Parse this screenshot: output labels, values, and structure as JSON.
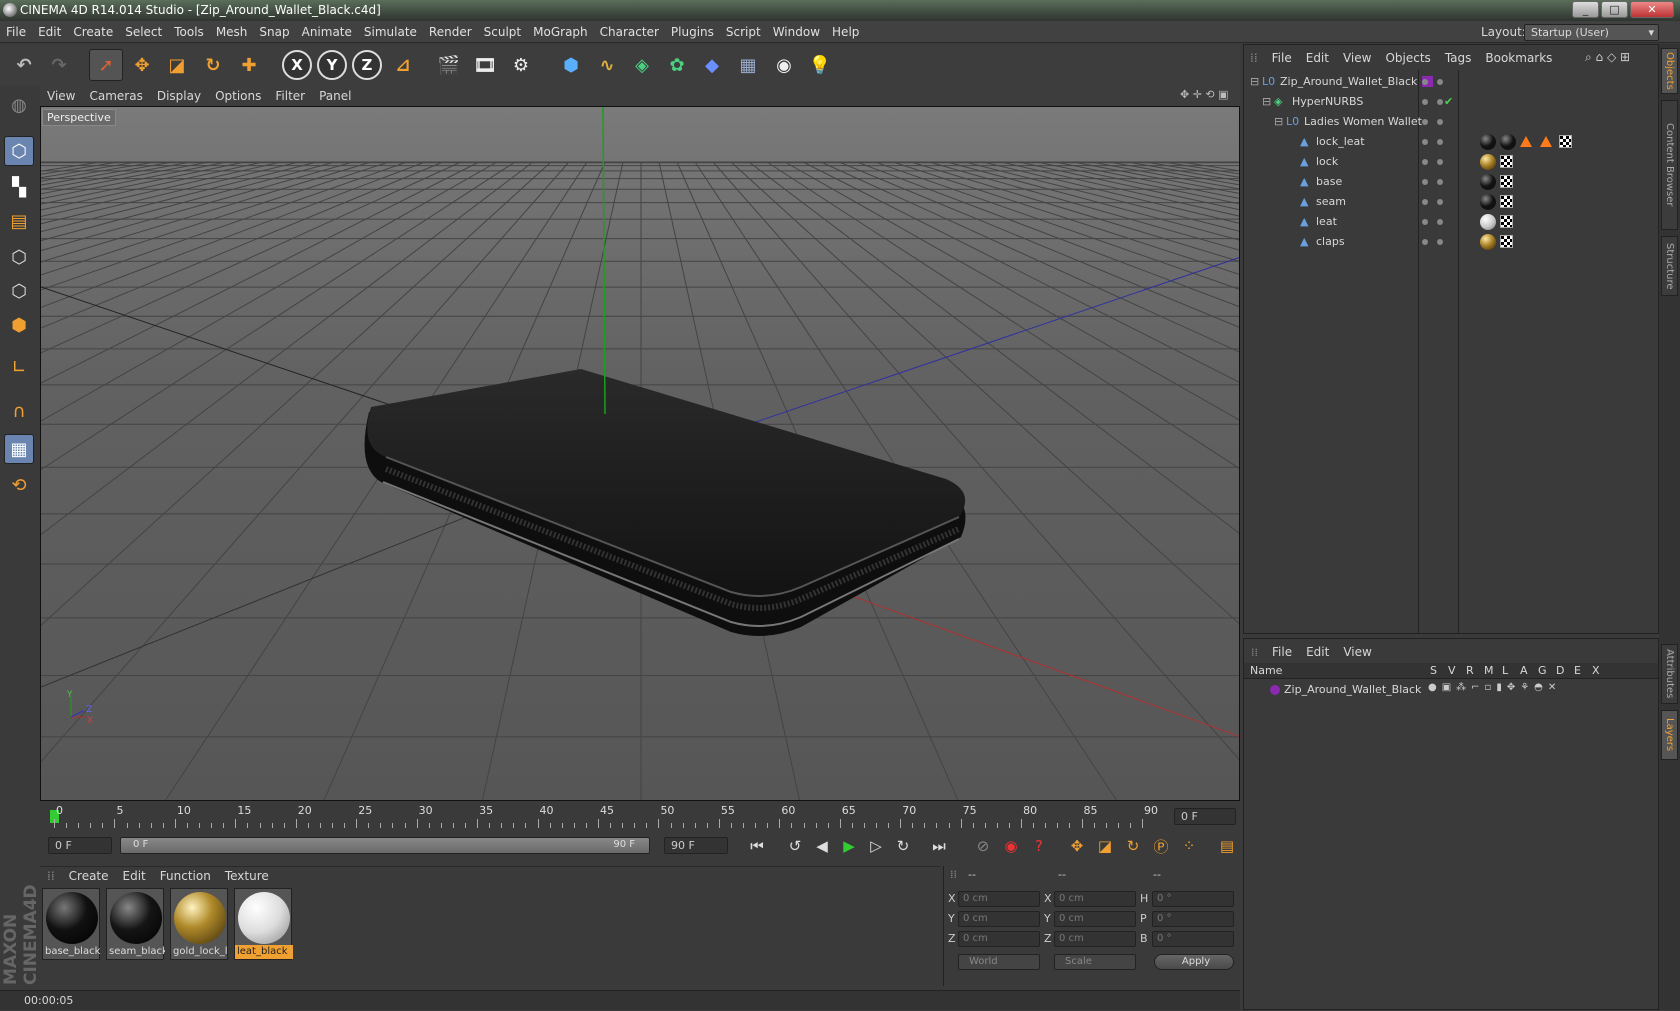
{
  "window": {
    "title": "CINEMA 4D R14.014 Studio - [Zip_Around_Wallet_Black.c4d]",
    "min": "_",
    "max": "□",
    "close": "✕"
  },
  "menubar": [
    "File",
    "Edit",
    "Create",
    "Select",
    "Tools",
    "Mesh",
    "Snap",
    "Animate",
    "Simulate",
    "Render",
    "Sculpt",
    "MoGraph",
    "Character",
    "Plugins",
    "Script",
    "Window",
    "Help"
  ],
  "layout": {
    "label": "Layout:",
    "value": "Startup (User)"
  },
  "toolbar": {
    "icons": [
      "undo-icon",
      "redo-icon",
      "live-select-icon",
      "move-icon",
      "scale-icon",
      "rotate-icon",
      "add-icon"
    ],
    "axes": [
      "X",
      "Y",
      "Z"
    ]
  },
  "viewport": {
    "menu": [
      "View",
      "Cameras",
      "Display",
      "Options",
      "Filter",
      "Panel"
    ],
    "label": "Perspective",
    "axis_y": "Y",
    "axis_z": "Z",
    "axis_x": "X"
  },
  "timeline": {
    "ticks": [
      "0",
      "5",
      "10",
      "15",
      "20",
      "25",
      "30",
      "35",
      "40",
      "45",
      "50",
      "55",
      "60",
      "65",
      "70",
      "75",
      "80",
      "85",
      "90"
    ],
    "current": "0 F",
    "start": "0 F",
    "range_start": "0 F",
    "range_end": "90 F",
    "end": "90 F"
  },
  "materials": {
    "menu": [
      "Create",
      "Edit",
      "Function",
      "Texture"
    ],
    "items": [
      {
        "name": "base_black",
        "color": "#111111"
      },
      {
        "name": "seam_black",
        "color": "#151515"
      },
      {
        "name": "gold_lock_l",
        "color": "#b08a2a"
      },
      {
        "name": "leat_black",
        "color": "#f0f0f0",
        "selected": true
      }
    ]
  },
  "coords": {
    "header": [
      "--",
      "--",
      "--"
    ],
    "rows": [
      {
        "a": "X",
        "v1": "0 cm",
        "b": "X",
        "v2": "0 cm",
        "c": "H",
        "v3": "0 °"
      },
      {
        "a": "Y",
        "v1": "0 cm",
        "b": "Y",
        "v2": "0 cm",
        "c": "P",
        "v3": "0 °"
      },
      {
        "a": "Z",
        "v1": "0 cm",
        "b": "Z",
        "v2": "0 cm",
        "c": "B",
        "v3": "0 °"
      }
    ],
    "world": "World",
    "scale": "Scale",
    "apply": "Apply"
  },
  "status": "00:00:05",
  "objects": {
    "menu": [
      "File",
      "Edit",
      "View",
      "Objects",
      "Tags",
      "Bookmarks"
    ],
    "tree": [
      {
        "name": "Zip_Around_Wallet_Black",
        "level": 0
      },
      {
        "name": "HyperNURBS",
        "level": 1
      },
      {
        "name": "Ladies Women Wallet",
        "level": 2
      },
      {
        "name": "lock_leat",
        "level": 3
      },
      {
        "name": "lock",
        "level": 3
      },
      {
        "name": "base",
        "level": 3
      },
      {
        "name": "seam",
        "level": 3
      },
      {
        "name": "leat",
        "level": 3
      },
      {
        "name": "claps",
        "level": 3
      }
    ]
  },
  "layers": {
    "menu": [
      "File",
      "Edit",
      "View"
    ],
    "cols": [
      "Name",
      "S",
      "V",
      "R",
      "M",
      "L",
      "A",
      "G",
      "D",
      "E",
      "X"
    ],
    "row": "Zip_Around_Wallet_Black"
  },
  "sidetabs": [
    "Objects",
    "Content Browser",
    "Structure",
    "Attributes",
    "Layers"
  ]
}
